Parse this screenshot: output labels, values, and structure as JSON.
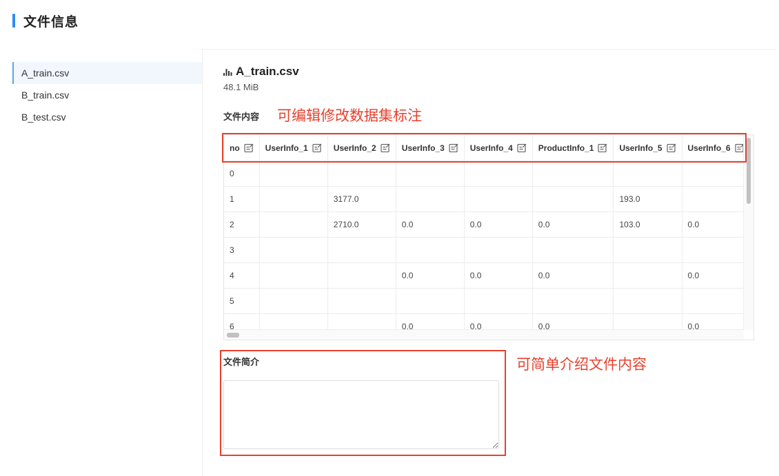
{
  "header": {
    "title": "文件信息"
  },
  "files": [
    "A_train.csv",
    "B_train.csv",
    "B_test.csv"
  ],
  "selected": {
    "name": "A_train.csv",
    "size": "48.1 MiB"
  },
  "content_label": "文件内容",
  "table": {
    "columns": [
      "no",
      "UserInfo_1",
      "UserInfo_2",
      "UserInfo_3",
      "UserInfo_4",
      "ProductInfo_1",
      "UserInfo_5",
      "UserInfo_6"
    ],
    "rows": [
      [
        "0",
        "",
        "",
        "",
        "",
        "",
        "",
        ""
      ],
      [
        "1",
        "",
        "3177.0",
        "",
        "",
        "",
        "193.0",
        ""
      ],
      [
        "2",
        "",
        "2710.0",
        "0.0",
        "0.0",
        "0.0",
        "103.0",
        "0.0"
      ],
      [
        "3",
        "",
        "",
        "",
        "",
        "",
        "",
        ""
      ],
      [
        "4",
        "",
        "",
        "0.0",
        "0.0",
        "0.0",
        "",
        "0.0"
      ],
      [
        "5",
        "",
        "",
        "",
        "",
        "",
        "",
        ""
      ],
      [
        "6",
        "",
        "",
        "0.0",
        "0.0",
        "0.0",
        "",
        "0.0"
      ]
    ]
  },
  "intro": {
    "label": "文件简介",
    "value": ""
  },
  "annotations": {
    "edit_note": "可编辑修改数据集标注",
    "intro_note": "可简单介绍文件内容"
  },
  "colors": {
    "accent": "#2b8cf4",
    "annotation": "#e8402d"
  }
}
